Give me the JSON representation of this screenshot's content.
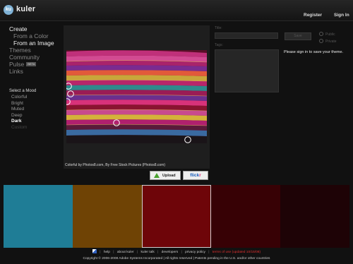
{
  "header": {
    "logo_mark": "ku",
    "app_name": "kuler",
    "register_label": "Register",
    "signin_label": "Sign In"
  },
  "nav": {
    "create": "Create",
    "from_color": "From a Color",
    "from_image": "From an Image",
    "themes": "Themes",
    "community": "Community",
    "pulse": "Pulse",
    "pulse_badge": "BETA",
    "links": "Links"
  },
  "mood": {
    "title": "Select a Mood",
    "options": [
      "Colorful",
      "Bright",
      "Muted",
      "Deep",
      "Dark",
      "Custom"
    ],
    "selected": "Dark"
  },
  "image": {
    "caption": "Colorful by Photos8.com, By Free Stock Pictures (Photos8.com)",
    "pickers": [
      {
        "name": "color-picker-1",
        "color": "#bb2833"
      },
      {
        "name": "color-picker-2",
        "color": "#8b1a4f"
      },
      {
        "name": "color-picker-3",
        "color": "#7a0a1a"
      },
      {
        "name": "color-picker-4",
        "color": "#2a1008"
      },
      {
        "name": "color-picker-5",
        "color": "#5b87a8"
      }
    ]
  },
  "buttons": {
    "upload_label": "Upload",
    "flickr_part1": "flick",
    "flickr_part2": "r"
  },
  "theme_form": {
    "title_label": "Title:",
    "save_label": "Save",
    "public_label": "Public",
    "private_label": "Private",
    "tags_label": "Tags:",
    "signin_message": "Please sign in to save your theme."
  },
  "swatches": [
    {
      "hex": "#1f7d96",
      "selected": false
    },
    {
      "hex": "#6f4305",
      "selected": false
    },
    {
      "hex": "#6e0509",
      "selected": true
    },
    {
      "hex": "#370105",
      "selected": false
    },
    {
      "hex": "#1e0306",
      "selected": false
    }
  ],
  "footer": {
    "links": [
      "help",
      "about kuler",
      "kuler talk",
      "developers",
      "privacy policy"
    ],
    "terms": "terms of use (updated 10/15/08)",
    "copyright": "Copyright © 2006-2008 Adobe Systems Incorporated | All rights reserved | Patents pending in the U.S. and/or other countries"
  }
}
